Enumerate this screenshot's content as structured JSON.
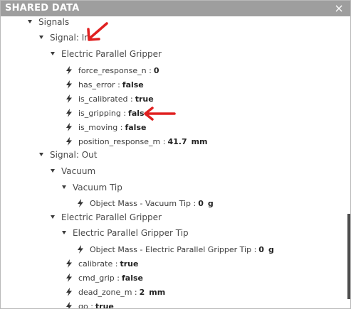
{
  "panel": {
    "title": "SHARED DATA",
    "close_glyph": "×"
  },
  "tree": {
    "root_label": "Signals",
    "signal_in": {
      "label": "Signal: In",
      "gripper": {
        "label": "Electric Parallel Gripper",
        "fields": [
          {
            "name": "force_response_n",
            "value": "0",
            "unit": ""
          },
          {
            "name": "has_error",
            "value": "false",
            "unit": ""
          },
          {
            "name": "is_calibrated",
            "value": "true",
            "unit": ""
          },
          {
            "name": "is_gripping",
            "value": "false",
            "unit": ""
          },
          {
            "name": "is_moving",
            "value": "false",
            "unit": ""
          },
          {
            "name": "position_response_m",
            "value": "41.7",
            "unit": "mm"
          }
        ]
      }
    },
    "signal_out": {
      "label": "Signal: Out",
      "vacuum": {
        "label": "Vacuum",
        "tip": {
          "label": "Vacuum Tip",
          "field": {
            "name": "Object Mass - Vacuum Tip",
            "value": "0",
            "unit": "g"
          }
        }
      },
      "gripper": {
        "label": "Electric Parallel Gripper",
        "tip": {
          "label": "Electric Parallel Gripper Tip",
          "field": {
            "name": "Object Mass - Electric Parallel Gripper Tip",
            "value": "0",
            "unit": "g"
          }
        },
        "fields": [
          {
            "name": "calibrate",
            "value": "true",
            "unit": ""
          },
          {
            "name": "cmd_grip",
            "value": "false",
            "unit": ""
          },
          {
            "name": "dead_zone_m",
            "value": "2",
            "unit": "mm"
          },
          {
            "name": "go",
            "value": "true",
            "unit": ""
          }
        ]
      }
    }
  },
  "colors": {
    "titlebar": "#9e9e9e",
    "annotation_arrow": "#e02020"
  },
  "icons": {
    "expand": "caret-down-icon",
    "signal": "lightning-bolt-icon"
  }
}
